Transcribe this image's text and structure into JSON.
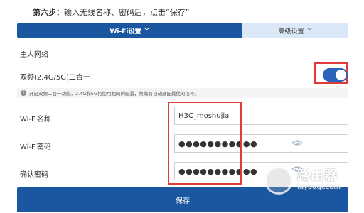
{
  "step": {
    "prefix": "第六步：",
    "text": "输入无线名称、密码后，点击“保存”"
  },
  "tabs": [
    {
      "label": "Wi-Fi设置",
      "active": true
    },
    {
      "label": "高级设置",
      "active": false
    }
  ],
  "chevron": "﹀",
  "section": {
    "title": "主人网络"
  },
  "dual_band": {
    "label": "双频(2.4G/5G)二合一",
    "enabled": true
  },
  "notice": {
    "text": "开启双频二合一功能，2.4G和5G将使用相同的配置，终端将自动适配最优的信号。"
  },
  "fields": {
    "ssid": {
      "label": "Wi-Fi名称",
      "value": "H3C_moshujia"
    },
    "password": {
      "label": "Wi-Fi密码",
      "value": "●●●●●●●●●●●"
    },
    "confirm": {
      "label": "确认密码",
      "value": "●●●●●●●●●●●"
    }
  },
  "save": {
    "label": "保存"
  },
  "watermark": {
    "name": "路由器",
    "url": "luyouqi.com"
  },
  "colors": {
    "primary": "#1a57a0",
    "tab_inactive": "#d9e7f6",
    "highlight": "#e03a3a",
    "toggle_on": "#2b63b8"
  }
}
